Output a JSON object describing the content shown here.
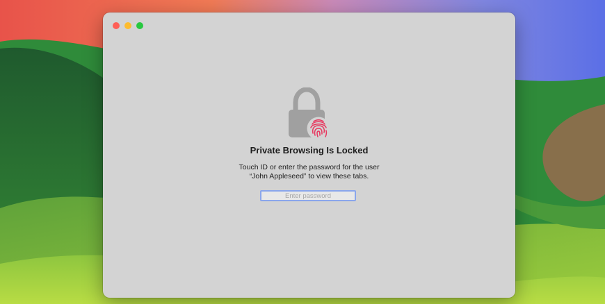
{
  "lock_screen": {
    "title": "Private Browsing Is Locked",
    "message_line1": "Touch ID or enter the password for the user",
    "message_line2": "“John Appleseed” to view these tabs.",
    "password_placeholder": "Enter password",
    "password_value": ""
  },
  "icons": {
    "lock": "lock-icon",
    "fingerprint": "fingerprint-icon"
  },
  "colors": {
    "window_bg": "#d3d3d3",
    "lock_gray": "#a0a0a0",
    "fingerprint_red": "#e8365e",
    "input_focus": "#8aa6ec",
    "traffic_close": "#fe5f57",
    "traffic_minimize": "#febc2e",
    "traffic_zoom": "#28c840"
  }
}
